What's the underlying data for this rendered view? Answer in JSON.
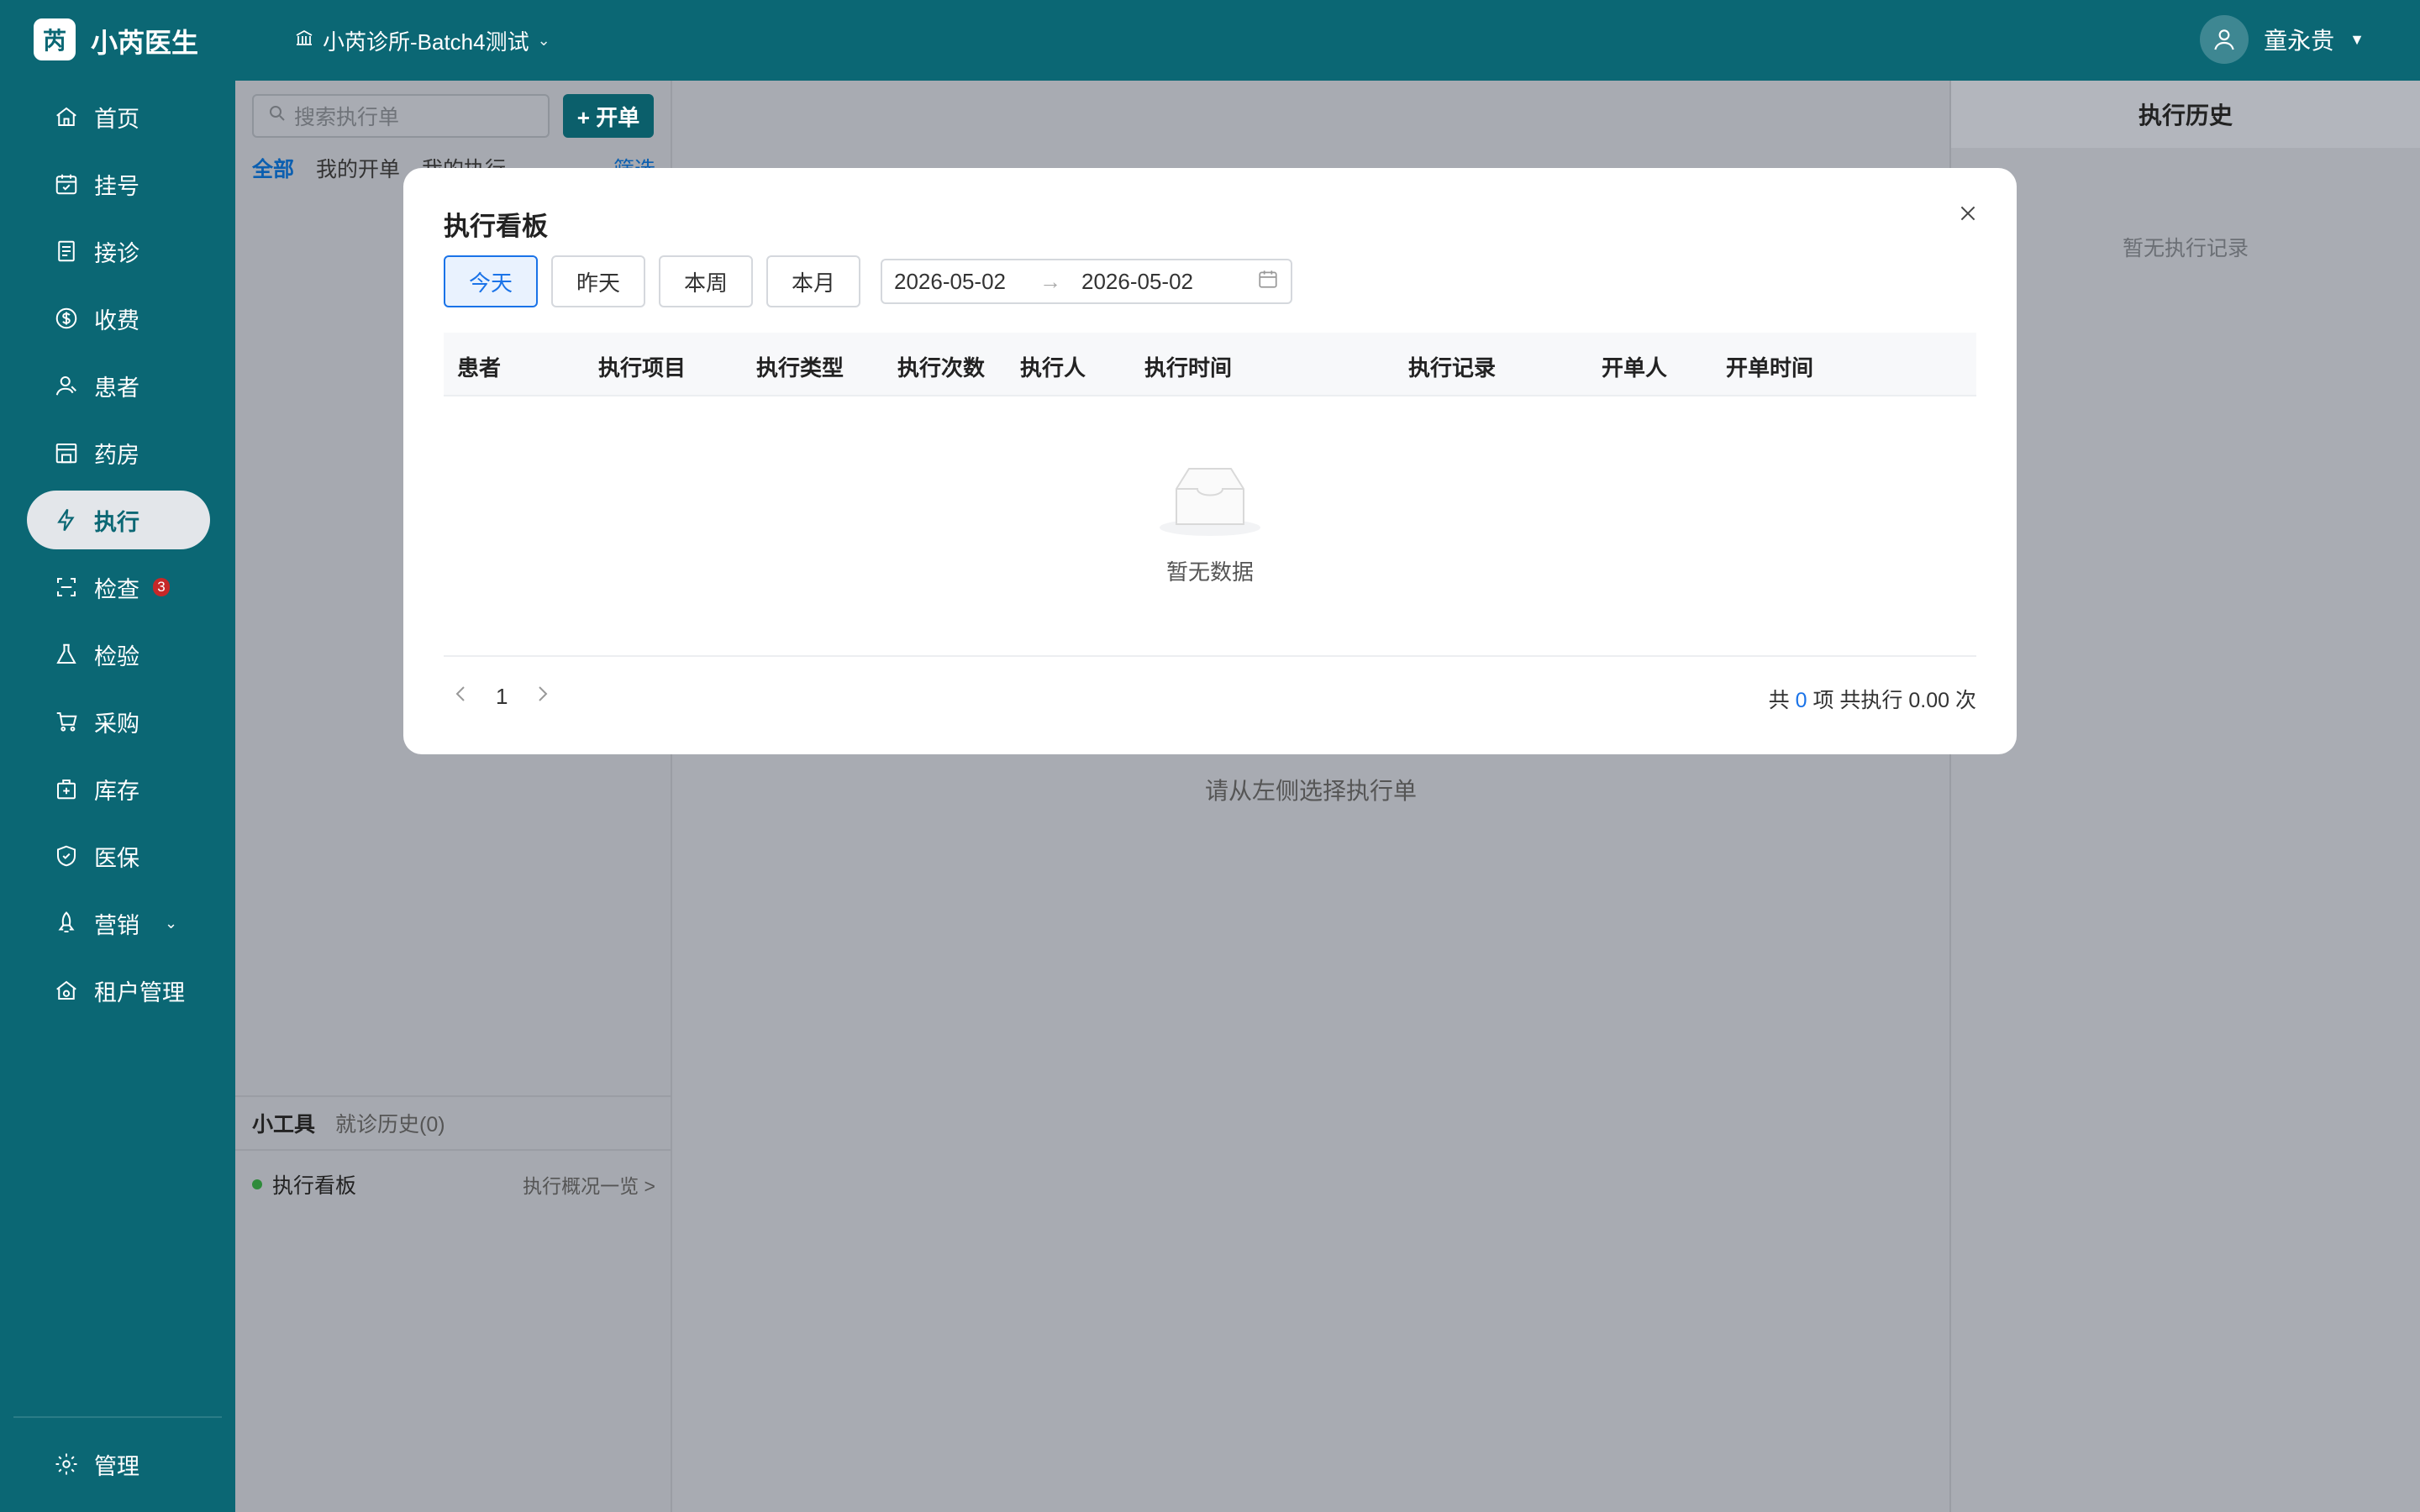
{
  "app": {
    "logo_char": "芮",
    "name": "小芮医生",
    "clinic": "小芮诊所-Batch4测试",
    "user": "童永贵"
  },
  "sidebar": {
    "items": [
      {
        "label": "首页",
        "icon": "home-icon"
      },
      {
        "label": "挂号",
        "icon": "calendar-icon"
      },
      {
        "label": "接诊",
        "icon": "clipboard-icon"
      },
      {
        "label": "收费",
        "icon": "dollar-icon"
      },
      {
        "label": "患者",
        "icon": "user-icon"
      },
      {
        "label": "药房",
        "icon": "store-icon"
      },
      {
        "label": "执行",
        "icon": "lightning-icon",
        "active": true
      },
      {
        "label": "检查",
        "icon": "scan-icon",
        "badge": "3"
      },
      {
        "label": "检验",
        "icon": "flask-icon"
      },
      {
        "label": "采购",
        "icon": "cart-icon"
      },
      {
        "label": "库存",
        "icon": "box-icon"
      },
      {
        "label": "医保",
        "icon": "shield-icon"
      },
      {
        "label": "营销",
        "icon": "rocket-icon"
      },
      {
        "label": "租户管理",
        "icon": "house-gear-icon"
      }
    ],
    "footer": "管理"
  },
  "list_panel": {
    "search_placeholder": "搜索执行单",
    "new_button": "+ 开单",
    "tabs": [
      "全部",
      "我的开单",
      "我的执行"
    ],
    "filter": "筛选",
    "tools_tabs": [
      "小工具",
      "就诊历史(0)"
    ],
    "tool_item": "执行看板",
    "tool_link": "执行概况一览 >"
  },
  "main": {
    "hint": "请从左侧选择执行单"
  },
  "history": {
    "title": "执行历史",
    "empty": "暂无执行记录"
  },
  "modal": {
    "title": "执行看板",
    "range_buttons": [
      "今天",
      "昨天",
      "本周",
      "本月"
    ],
    "active_range": "今天",
    "date_start": "2026-05-02",
    "date_end": "2026-05-02",
    "columns": [
      "患者",
      "执行项目",
      "执行类型",
      "执行次数",
      "执行人",
      "执行时间",
      "执行记录",
      "开单人",
      "开单时间"
    ],
    "empty_text": "暂无数据",
    "page": "1",
    "summary_prefix": "共",
    "summary_count": "0",
    "summary_mid": "项 共执行",
    "summary_times": "0.00",
    "summary_suffix": "次"
  },
  "colors": {
    "brand": "#0b6774",
    "accent": "#1a73e8",
    "badge": "#c62828"
  }
}
